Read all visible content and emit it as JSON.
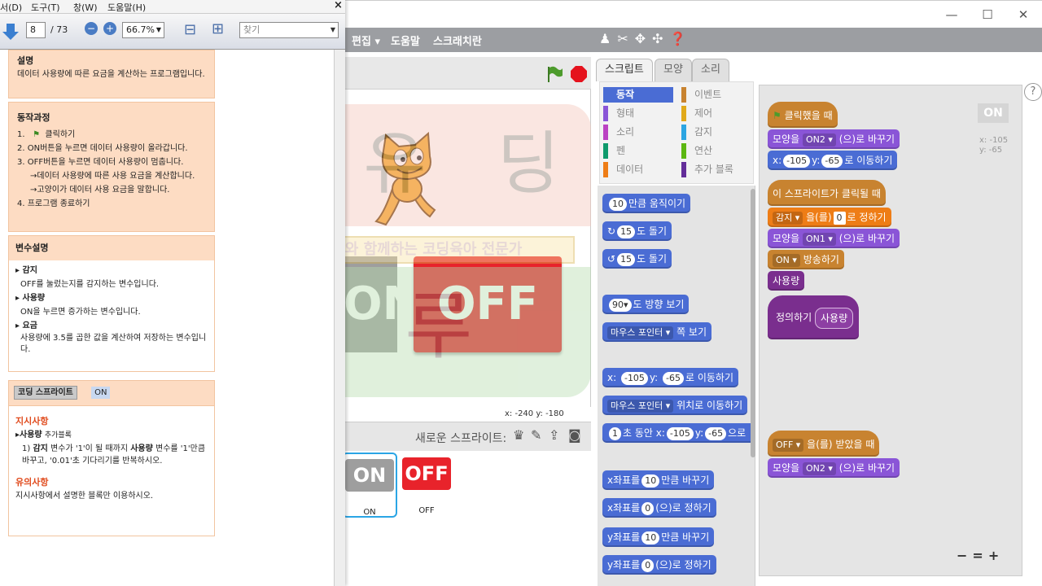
{
  "pdf": {
    "menu": [
      "서(D)",
      "도구(T)",
      "창(W)",
      "도움말(H)"
    ],
    "close": "×",
    "page_current": "8",
    "page_total": "/ 73",
    "zoom": "66.7%",
    "search_placeholder": "찾기",
    "sections": {
      "desc_title": "설명",
      "desc_text": "데이터 사용량에 따른 요금을 계산하는 프로그램입니다.",
      "proc_title": "동작과정",
      "proc_1": "1.",
      "proc_1_text": "클릭하기",
      "proc_2": "2.  ON버튼을 누르면 데이터 사용량이 올라갑니다.",
      "proc_3": "3.  OFF버튼을 누르면 데이터 사용량이 멈춥니다.",
      "proc_3a": "→데이터 사용량에 따른 사용 요금을 계산합니다.",
      "proc_3b": "→고양이가 데이터 사용 요금을 말합니다.",
      "proc_4": "4.  프로그램 종료하기",
      "var_title": "변수설명",
      "var1_name": "▸ 감지",
      "var1_desc": "OFF를 눌렀는지를 감지하는 변수입니다.",
      "var2_name": "▸ 사용량",
      "var2_desc": "ON을 누르면 증가하는 변수입니다.",
      "var3_name": "▸ 요금",
      "var3_desc": "사용량에 3.5를 곱한 값을 계산하여 저장하는 변수입니다.",
      "sprite_label": "코딩 스프라이트",
      "sprite_value": "ON",
      "instr_title": "지시사항",
      "instr_1": "사용량",
      "instr_1b": "추가블록",
      "instr_2a": "1) ",
      "instr_2b": "감지",
      "instr_2c": " 변수가 '1'이 될 때까지 ",
      "instr_2d": "사용량",
      "instr_2e": " 변수를 '1'만큼 바꾸고, '0.01'초 기다리기를 반복하시오.",
      "note_title": "유의사항",
      "note_text": "지시사항에서 설명한 블록만 이용하시오."
    }
  },
  "watermark": {
    "line1": "엄마와 함께하는 코딩육아 전문가",
    "big1": "J 유 딩",
    "big2": "청 루 빈"
  },
  "scratch": {
    "window_buttons": [
      "—",
      "☐",
      "✕"
    ],
    "menu": [
      "편집 ▾",
      "도움말",
      "스크래치란"
    ],
    "coords": "x: -240  y: -180",
    "new_sprite_label": "새로운 스프라이트:",
    "sprites": [
      {
        "tile": "ON",
        "name": "ON",
        "color": "#9e9e9e"
      },
      {
        "tile": "OFF",
        "name": "OFF",
        "color": "#e8232b"
      }
    ],
    "stage_on": "ON",
    "stage_off": "OFF",
    "tabs": [
      "스크립트",
      "모양",
      "소리"
    ],
    "categories": [
      {
        "label": "동작",
        "color": "#4a6cd4",
        "selected": true
      },
      {
        "label": "이벤트",
        "color": "#c88330"
      },
      {
        "label": "형태",
        "color": "#8a55d7"
      },
      {
        "label": "제어",
        "color": "#e1a91a"
      },
      {
        "label": "소리",
        "color": "#bb42c3"
      },
      {
        "label": "감지",
        "color": "#2ca5e2"
      },
      {
        "label": "펜",
        "color": "#0e9a6c"
      },
      {
        "label": "연산",
        "color": "#5cb712"
      },
      {
        "label": "데이터",
        "color": "#ee7d16"
      },
      {
        "label": "추가 블록",
        "color": "#632d99"
      }
    ],
    "palette": {
      "move_n": "10",
      "move_t": "만큼 움직이기",
      "turn_r_n": "15",
      "turn_r_t": "도 돌기",
      "turn_l_n": "15",
      "turn_l_t": "도 돌기",
      "dir_n": "90▾",
      "dir_t": "도 방향 보기",
      "point_d": "마우스 포인터 ▾",
      "point_t": "쪽 보기",
      "goto_x": "-105",
      "goto_y": "-65",
      "goto_t": "로 이동하기",
      "goto2_d": "마우스 포인터 ▾",
      "goto2_t": "위치로 이동하기",
      "glide_n": "1",
      "glide_t1": "초 동안 x:",
      "glide_x": "-105",
      "glide_t2": "y:",
      "glide_y": "-65",
      "glide_t3": "으로",
      "cx_t1": "x좌표를",
      "cx_n": "10",
      "cx_t2": "만큼 바꾸기",
      "sx_t1": "x좌표를",
      "sx_n": "0",
      "sx_t2": "(으)로 정하기",
      "cy_t1": "y좌표를",
      "cy_n": "10",
      "cy_t2": "만큼 바꾸기",
      "sy_t1": "y좌표를",
      "sy_n": "0",
      "sy_t2": "(으)로 정하기"
    },
    "scripts": {
      "on_badge": "ON",
      "xy": "x: -105\ny: -65",
      "hat1": "클릭했을 때",
      "s1b1_t1": "모양을",
      "s1b1_d": "ON2 ▾",
      "s1b1_t2": "(으)로 바꾸기",
      "s1b2_t1": "x:",
      "s1b2_x": "-105",
      "s1b2_t2": "y:",
      "s1b2_y": "-65",
      "s1b2_t3": "로 이동하기",
      "hat2": "이 스프라이트가 클릭될 때",
      "s2b1_d": "감지 ▾",
      "s2b1_t1": "을(를)",
      "s2b1_n": "0",
      "s2b1_t2": "로 정하기",
      "s2b2_t1": "모양을",
      "s2b2_d": "ON1 ▾",
      "s2b2_t2": "(으)로 바꾸기",
      "s2b3_d": "ON ▾",
      "s2b3_t": "방송하기",
      "s2b4": "사용량",
      "def_t": "정의하기",
      "def_n": "사용량",
      "hat3_d": "OFF ▾",
      "hat3_t": "을(를) 받았을 때",
      "s3b1_t1": "모양을",
      "s3b1_d": "ON2 ▾",
      "s3b1_t2": "(으)로 바꾸기"
    },
    "zoom_controls": [
      "−",
      "=",
      "+"
    ]
  }
}
